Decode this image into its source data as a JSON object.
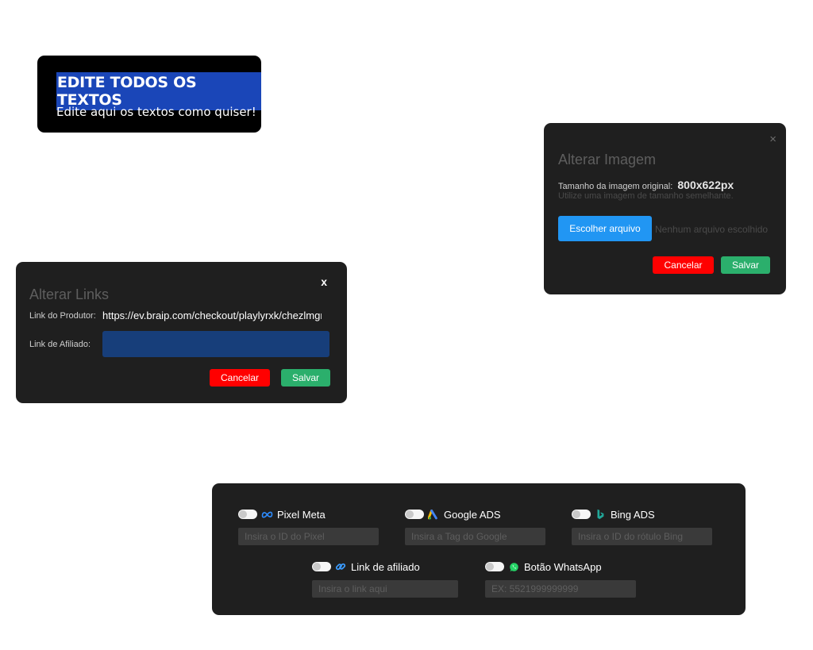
{
  "text_card": {
    "title": "EDITE TODOS OS TEXTOS",
    "subtitle": "Edite aqui os textos como quiser!"
  },
  "image_dialog": {
    "close": "×",
    "title": "Alterar Imagem",
    "size_label": "Tamanho da imagem original:",
    "size_value": "800x622px",
    "hint": "Utilize uma imagem de tamanho semelhante.",
    "file_button": "Escolher arquivo",
    "file_status": "Nenhum arquivo escolhido",
    "cancel": "Cancelar",
    "save": "Salvar"
  },
  "links_dialog": {
    "close": "x",
    "title": "Alterar Links",
    "producer_label": "Link do Produtor:",
    "producer_value": "https://ev.braip.com/checkout/playlyrxk/chezlmgr",
    "affiliate_label": "Link de Afiliado:",
    "affiliate_value": "",
    "cancel": "Cancelar",
    "save": "Salvar"
  },
  "tracking": {
    "pixel_meta": {
      "label": "Pixel Meta",
      "placeholder": "Insira o ID do Pixel",
      "icon": "meta-icon"
    },
    "google_ads": {
      "label": "Google ADS",
      "placeholder": "Insira a Tag do Google",
      "icon": "google-ads-icon"
    },
    "bing_ads": {
      "label": "Bing ADS",
      "placeholder": "Insira o ID do rótulo Bing",
      "icon": "bing-icon"
    },
    "affiliate_link": {
      "label": "Link de afiliado",
      "placeholder": "Insira o link aqui",
      "icon": "link-icon"
    },
    "whatsapp": {
      "label": "Botão WhatsApp",
      "placeholder": "EX: 5521999999999",
      "icon": "whatsapp-icon"
    }
  },
  "colors": {
    "panel_bg": "#1f1f1f",
    "primary": "#2196f3",
    "danger": "#ff0000",
    "success": "#2baf6c",
    "highlight": "#1a46b8"
  }
}
